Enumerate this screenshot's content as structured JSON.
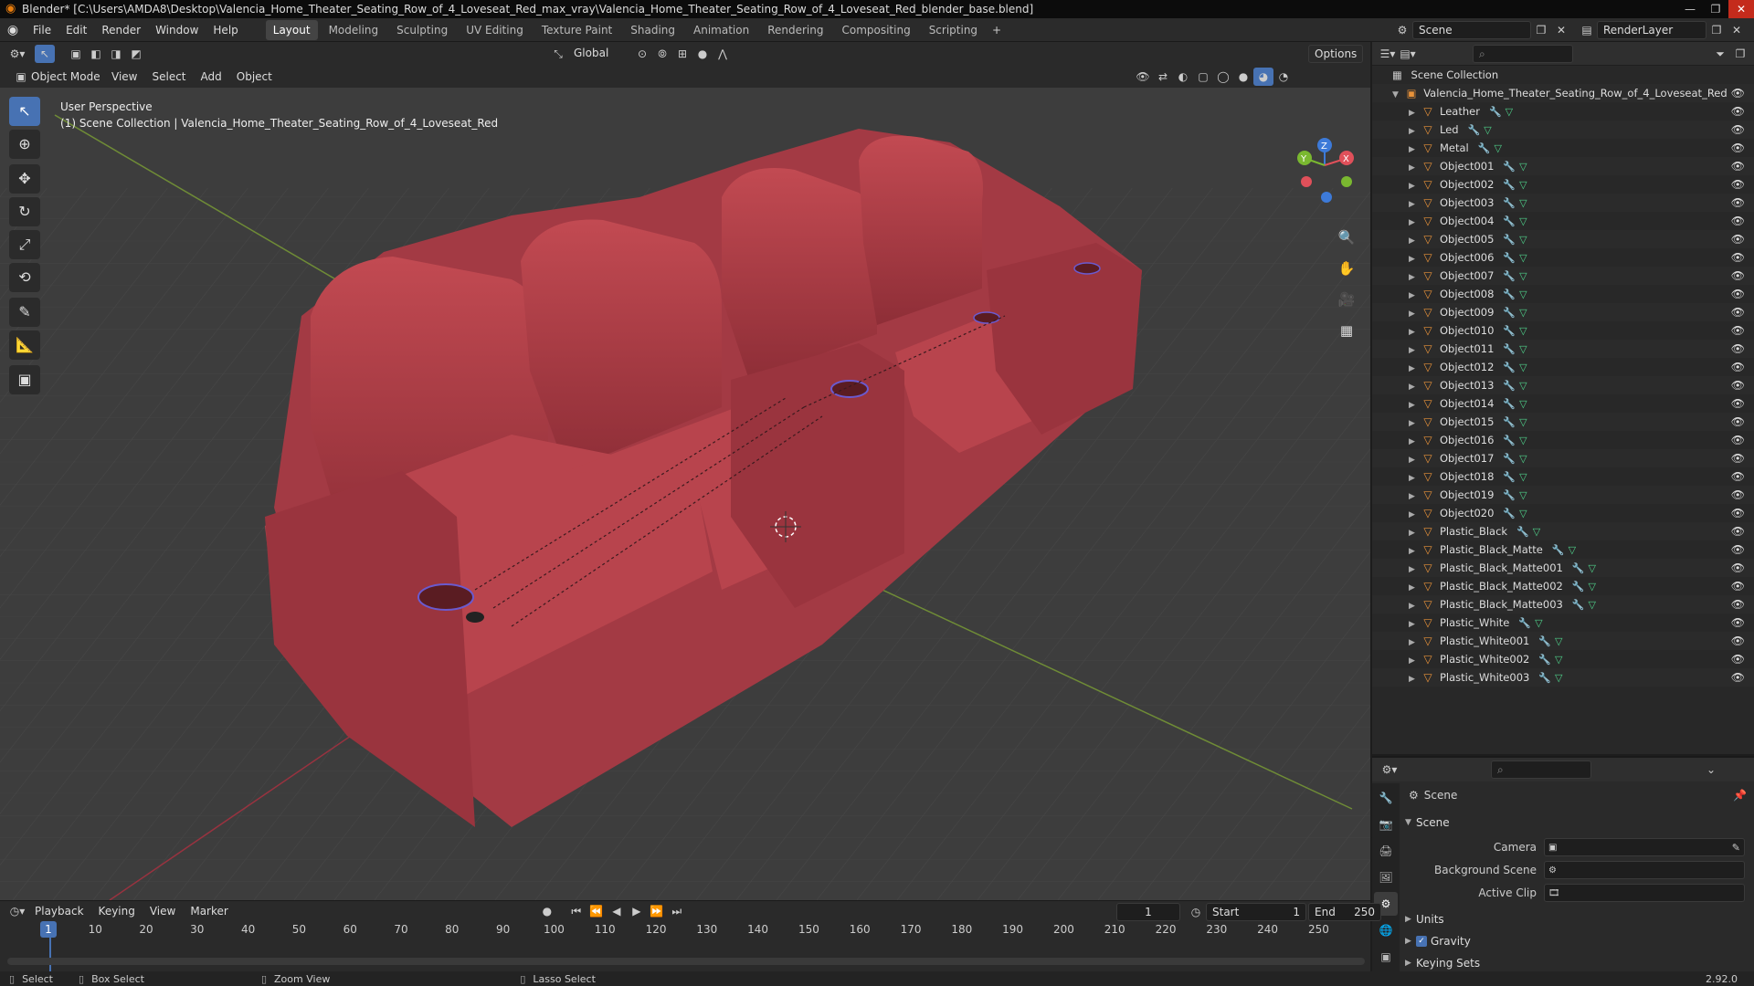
{
  "window": {
    "title": "Blender* [C:\\Users\\AMDA8\\Desktop\\Valencia_Home_Theater_Seating_Row_of_4_Loveseat_Red_max_vray\\Valencia_Home_Theater_Seating_Row_of_4_Loveseat_Red_blender_base.blend]"
  },
  "menu": [
    "File",
    "Edit",
    "Render",
    "Window",
    "Help"
  ],
  "workspaces": [
    "Layout",
    "Modeling",
    "Sculpting",
    "UV Editing",
    "Texture Paint",
    "Shading",
    "Animation",
    "Rendering",
    "Compositing",
    "Scripting"
  ],
  "scene_name": "Scene",
  "render_layer": "RenderLayer",
  "viewport": {
    "mode": "Object Mode",
    "menus": [
      "View",
      "Select",
      "Add",
      "Object"
    ],
    "transform_orientation": "Global",
    "options_label": "Options",
    "info_line1": "User Perspective",
    "info_line2": "(1) Scene Collection | Valencia_Home_Theater_Seating_Row_of_4_Loveseat_Red",
    "axis_x": "X",
    "axis_y": "Y",
    "axis_z": "Z"
  },
  "outliner": {
    "root": "Scene Collection",
    "collection": "Valencia_Home_Theater_Seating_Row_of_4_Loveseat_Red",
    "items": [
      "Leather",
      "Led",
      "Metal",
      "Object001",
      "Object002",
      "Object003",
      "Object004",
      "Object005",
      "Object006",
      "Object007",
      "Object008",
      "Object009",
      "Object010",
      "Object011",
      "Object012",
      "Object013",
      "Object014",
      "Object015",
      "Object016",
      "Object017",
      "Object018",
      "Object019",
      "Object020",
      "Plastic_Black",
      "Plastic_Black_Matte",
      "Plastic_Black_Matte001",
      "Plastic_Black_Matte002",
      "Plastic_Black_Matte003",
      "Plastic_White",
      "Plastic_White001",
      "Plastic_White002",
      "Plastic_White003"
    ]
  },
  "properties": {
    "header": "Scene",
    "section": "Scene",
    "camera_label": "Camera",
    "background_label": "Background Scene",
    "clip_label": "Active Clip",
    "units_label": "Units",
    "gravity_label": "Gravity",
    "keying_label": "Keying Sets"
  },
  "timeline": {
    "menus": [
      "Playback",
      "Keying",
      "View",
      "Marker"
    ],
    "current_frame": "1",
    "start_label": "Start",
    "start_value": "1",
    "end_label": "End",
    "end_value": "250",
    "ticks": [
      "10",
      "20",
      "30",
      "40",
      "50",
      "60",
      "70",
      "80",
      "90",
      "100",
      "110",
      "120",
      "130",
      "140",
      "150",
      "160",
      "170",
      "180",
      "190",
      "200",
      "210",
      "220",
      "230",
      "240",
      "250"
    ]
  },
  "status": {
    "select": "Select",
    "box_select": "Box Select",
    "zoom_view": "Zoom View",
    "lasso_select": "Lasso Select",
    "version": "2.92.0"
  }
}
